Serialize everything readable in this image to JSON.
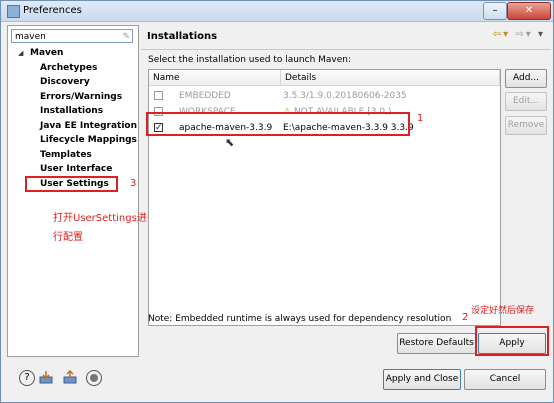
{
  "window": {
    "title": "Preferences",
    "buttons": {
      "minimize": "–",
      "maximize": "□",
      "close": "✕"
    }
  },
  "filter": {
    "value": "maven"
  },
  "tree": {
    "root": "Maven",
    "items": [
      "Archetypes",
      "Discovery",
      "Errors/Warnings",
      "Installations",
      "Java EE Integration",
      "Lifecycle Mappings",
      "Templates",
      "User Interface",
      "User Settings"
    ]
  },
  "page": {
    "title": "Installations",
    "description": "Select the installation used to launch Maven:",
    "columns": [
      "Name",
      "Details"
    ],
    "rows": [
      {
        "name": "EMBEDDED",
        "details": "3.5.3/1.9.0.20180606-2035",
        "checked": false,
        "disabled": true
      },
      {
        "name": "WORKSPACE",
        "details": "NOT AVAILABLE [3.0,)",
        "checked": false,
        "disabled": true,
        "warning": true
      },
      {
        "name": "apache-maven-3.3.9",
        "details": "E:\\apache-maven-3.3.9 3.3.9",
        "checked": true,
        "disabled": false
      }
    ],
    "buttons": {
      "add": "Add...",
      "edit": "Edit...",
      "remove": "Remove"
    },
    "note": "Note: Embedded runtime is always used for dependency resolution",
    "restore_defaults": "Restore Defaults",
    "apply": "Apply"
  },
  "footer": {
    "apply_close": "Apply and Close",
    "cancel": "Cancel"
  },
  "annotations": {
    "n1": "1",
    "n2": "2",
    "n3": "3",
    "open_settings_line1": "打开UserSettings进",
    "open_settings_line2": "行配置",
    "save_note": "设定好然后保存"
  },
  "colors": {
    "annotation_red": "#e02020",
    "accent_blue": "#3c7fb1"
  }
}
